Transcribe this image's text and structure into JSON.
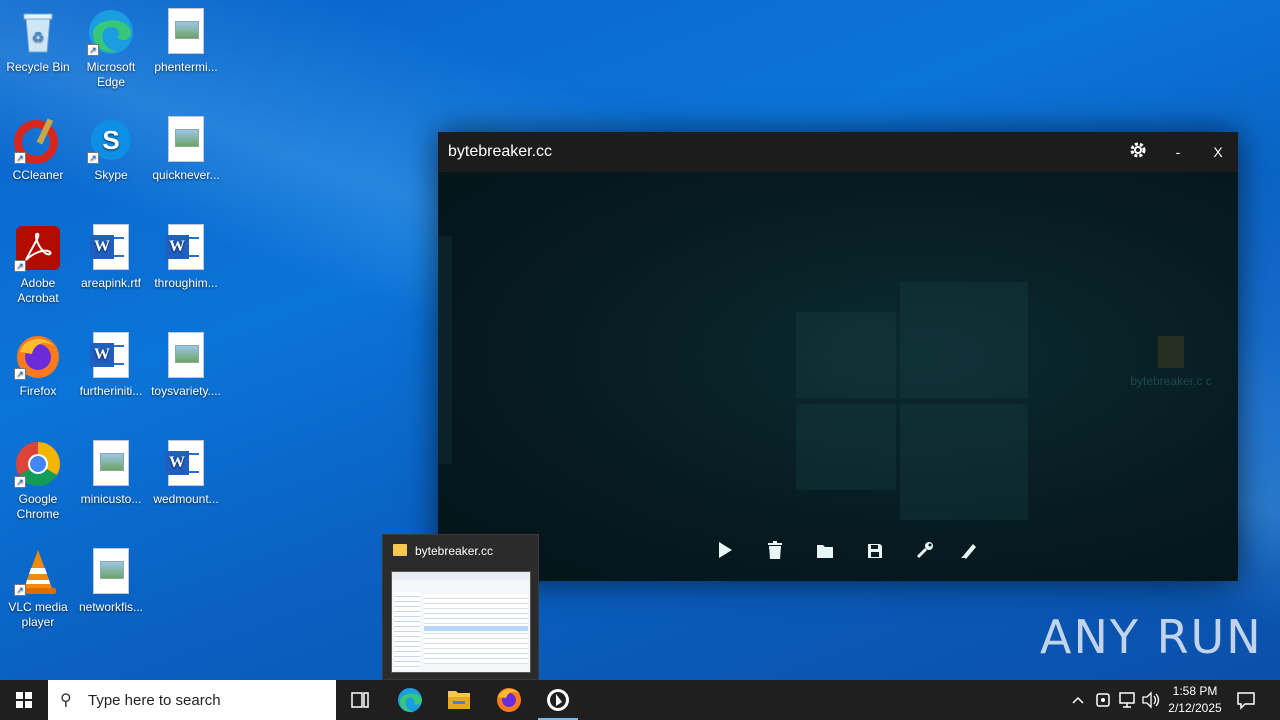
{
  "desktop": {
    "icons": [
      {
        "label": "Recycle Bin"
      },
      {
        "label": "Microsoft Edge"
      },
      {
        "label": "phentermi..."
      },
      {
        "label": "CCleaner"
      },
      {
        "label": "Skype"
      },
      {
        "label": "quicknever..."
      },
      {
        "label": "Adobe Acrobat"
      },
      {
        "label": "areapink.rtf"
      },
      {
        "label": "throughim..."
      },
      {
        "label": "Firefox"
      },
      {
        "label": "furtheriniti..."
      },
      {
        "label": "toysvariety...."
      },
      {
        "label": "Google Chrome"
      },
      {
        "label": "minicusto..."
      },
      {
        "label": "wedmount..."
      },
      {
        "label": "VLC media player"
      },
      {
        "label": "networkfis..."
      }
    ]
  },
  "app_window": {
    "title": "bytebreaker.cc",
    "settings_icon": "gear-icon",
    "minimize_label": "-",
    "close_label": "X",
    "ghost_file_label": "bytebreaker.c c",
    "toolbar": [
      "play-icon",
      "trash-icon",
      "folder-icon",
      "save-icon",
      "wrench-icon",
      "pen-icon"
    ]
  },
  "taskbar_preview": {
    "title": "bytebreaker.cc"
  },
  "taskbar": {
    "search_placeholder": "Type here to search",
    "clock_time": "1:58 PM",
    "clock_date": "2/12/2025"
  },
  "watermark": "ANY RUN",
  "colors": {
    "desktop_blue": "#0a63c9",
    "taskbar": "#1f1f1f",
    "app_titlebar": "#1c1c1c",
    "app_body": "#071c22"
  }
}
